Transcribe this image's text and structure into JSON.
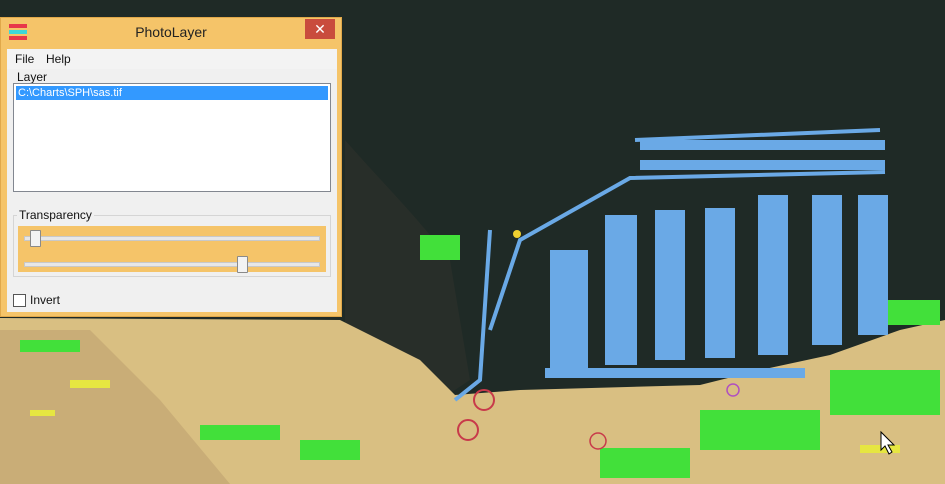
{
  "window": {
    "title": "PhotoLayer",
    "close_glyph": "✕"
  },
  "menu": {
    "file": "File",
    "help": "Help"
  },
  "layer_group": {
    "label": "Layer",
    "items": [
      "C:\\Charts\\SPH\\sas.tif"
    ]
  },
  "transparency_group": {
    "label": "Transparency",
    "slider_top_value": 0.02,
    "slider_bottom_value": 0.74
  },
  "invert": {
    "label": "Invert",
    "checked": false
  },
  "colors": {
    "window_frame": "#f5c469",
    "selection": "#3399ff",
    "close_button": "#c94c3d",
    "water": "#1f2a26",
    "land": "#d9bf82",
    "pontoon": "#6aa9e6",
    "vegetation": "#42e03a"
  },
  "icons": {
    "app": "photolayer-app-icon",
    "close": "close-icon",
    "cursor": "mouse-cursor-icon"
  }
}
